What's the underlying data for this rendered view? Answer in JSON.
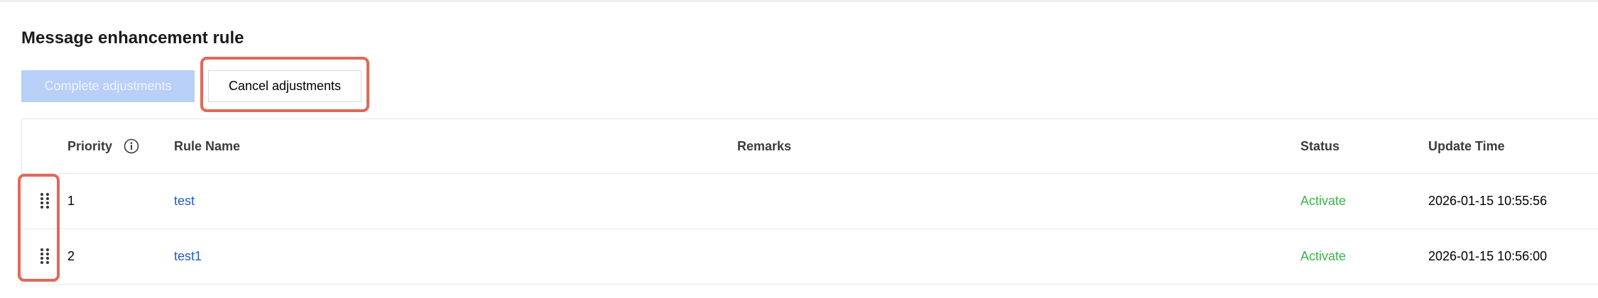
{
  "section": {
    "title": "Message enhancement rule"
  },
  "toolbar": {
    "complete_label": "Complete adjustments",
    "cancel_label": "Cancel adjustments"
  },
  "table": {
    "columns": {
      "priority": "Priority",
      "rule_name": "Rule Name",
      "remarks": "Remarks",
      "status": "Status",
      "update_time": "Update Time"
    },
    "rows": [
      {
        "priority": "1",
        "rule_name": "test",
        "remarks": "",
        "status": "Activate",
        "update_time": "2026-01-15 10:55:56"
      },
      {
        "priority": "2",
        "rule_name": "test1",
        "remarks": "",
        "status": "Activate",
        "update_time": "2026-01-15 10:56:00"
      }
    ]
  },
  "colors": {
    "primary_disabled": "#b8cff8",
    "link": "#1f5cc9",
    "status_active": "#3cb34a",
    "highlight": "#e0685a"
  },
  "icons": {
    "priority_info": "info-icon",
    "row_drag": "drag-handle-icon"
  }
}
